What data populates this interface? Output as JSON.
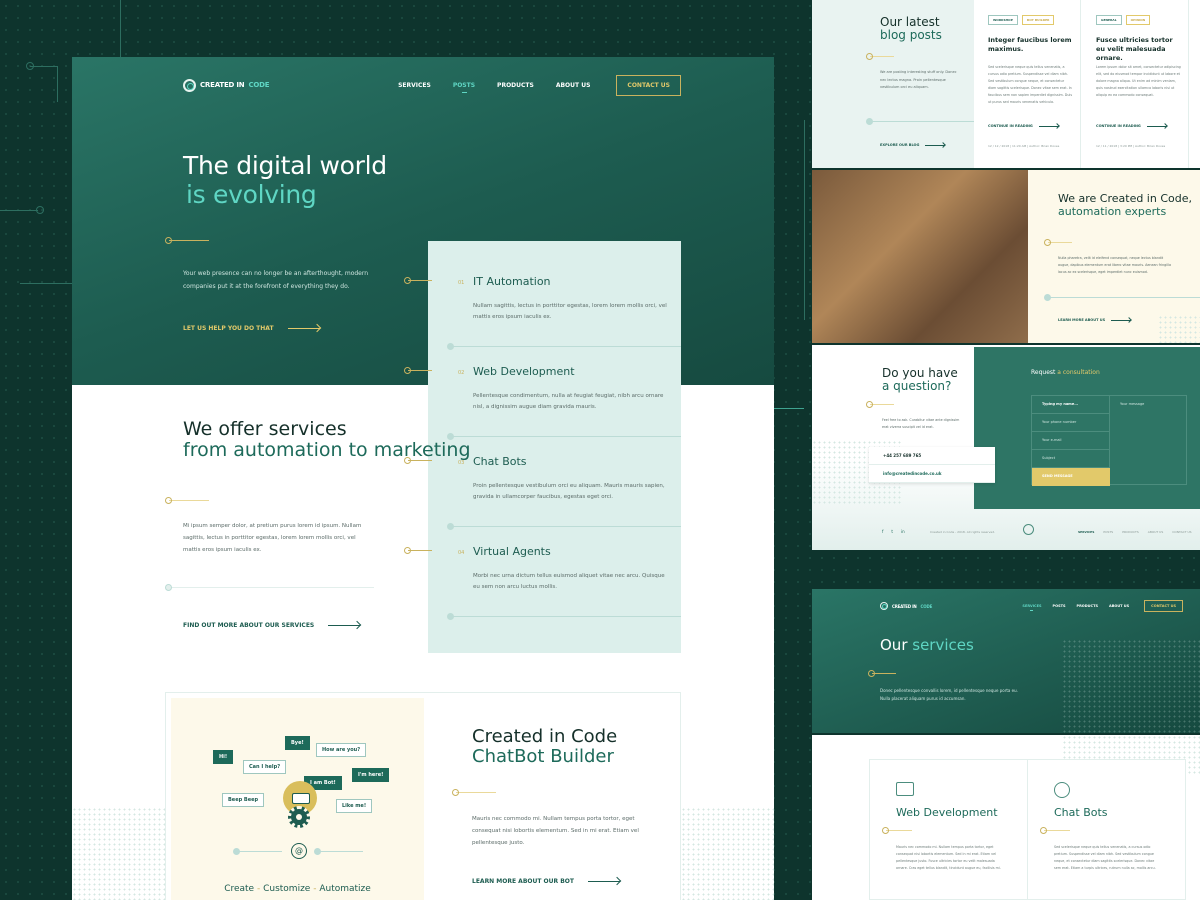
{
  "brand": {
    "name": "CREATED IN",
    "name_accent": "CODE"
  },
  "nav": {
    "items": [
      {
        "label": "SERVICES"
      },
      {
        "label": "POSTS",
        "active": true
      },
      {
        "label": "PRODUCTS"
      },
      {
        "label": "ABOUT US"
      }
    ],
    "contact_label": "CONTACT US"
  },
  "hero": {
    "title_line1": "The digital world",
    "title_line2": "is evolving",
    "text": "Your web presence can no longer be an afterthought, modern companies put it at the forefront of everything they do.",
    "cta": "LET US HELP YOU DO THAT"
  },
  "services": [
    {
      "num": "01",
      "title": "IT Automation",
      "text": "Nullam sagittis, lectus in porttitor egestas, lorem lorem mollis orci, vel mattis eros ipsum iaculis ex."
    },
    {
      "num": "02",
      "title": "Web Development",
      "text": "Pellentesque condimentum, nulla at feugiat feugiat, nibh arcu ornare nisl, a dignissim augue diam gravida mauris."
    },
    {
      "num": "03",
      "title": "Chat Bots",
      "text": "Proin pellentesque vestibulum orci eu aliquam. Mauris mauris sapien, gravida in ullamcorper faucibus, egestas eget orci."
    },
    {
      "num": "04",
      "title": "Virtual Agents",
      "text": "Morbi nec urna dictum tellus euismod aliquet vitae nec arcu. Quisque eu sem non arcu luctus mollis."
    }
  ],
  "offer": {
    "title_line1": "We offer services",
    "title_line2": "from automation to marketing",
    "text": "Mi ipsum semper dolor, at pretium purus lorem id ipsum. Nullam sagittis, lectus in porttitor egestas, lorem lorem mollis orci, vel mattis eros ipsum iaculis ex.",
    "cta": "FIND OUT MORE ABOUT OUR SERVICES"
  },
  "chatbot": {
    "bubbles": [
      "Hi!",
      "Bye!",
      "How are you?",
      "Can I help?",
      "I am Bot!",
      "I'm here!",
      "Beep Beep",
      "Like me!"
    ],
    "tagline": [
      "Create",
      "Customize",
      "Automatize"
    ],
    "separator": "-",
    "title_line1": "Created in Code",
    "title_line2": "ChatBot Builder",
    "text": "Mauris nec commodo mi. Nullam tempus porta tortor, eget consequat nisi lobortis elementum. Sed in mi erat. Etiam vel pellentesque justo.",
    "cta": "LEARN MORE ABOUT OUR BOT"
  },
  "blog": {
    "title_line1": "Our latest",
    "title_line2": "blog posts",
    "text": "We are posting interesting stuff only. Donec nec lectus magna. Proin pellentesque vestibulum orci eu aliquam.",
    "cta": "EXPLORE OUR BLOG",
    "posts": [
      {
        "tags": [
          "WORKSHOP",
          "BOT BUILDER"
        ],
        "title": "Integer faucibus lorem maximus.",
        "text": "Sed scelerisque neque quis tellus venenatis, a cursus odio pretium. Suspendisse vel diam nibh. Sed vestibulum congue neque, et consectetur diam sagittis scelerisque. Donec vitae sem erat. In faucibus sem non sapien imperdiet dignissim. Duis ut purus sed mauris venenatis vehicula.",
        "cta": "CONTINUE IN READING",
        "meta": "12 / 12 / 2018 | 11:20 AM | Author: Brian Doves"
      },
      {
        "tags": [
          "GENERAL",
          "OPINION"
        ],
        "title": "Fusce ultricies tortor eu velit malesuada ornare.",
        "text": "Lorem ipsum dolor sit amet, consectetur adipiscing elit, sed do eiusmod tempor incididunt ut labore et dolore magna aliqua. Ut enim ad minim veniam, quis nostrud exercitation ullamco laboris nisi ut aliquip ex ea commodo consequat.",
        "cta": "CONTINUE IN READING",
        "meta": "12 / 11 / 2018 | 3:20 PM | Author: Brian Doves"
      }
    ]
  },
  "about": {
    "title_line1": "We are Created in Code,",
    "title_accent": "automation experts",
    "text": "Nulla pharetra, velit id eleifend consequat, neque lectus blandit augue, dapibus elementum erat libero vitae mauris. Aenean fringilla lacus ac ex scelerisque, eget imperdiet nunc euismod.",
    "cta": "LEARN MORE ABOUT US"
  },
  "question": {
    "title_line1": "Do you have",
    "title_line2": "a question?",
    "text": "Feel free to ask. Curabitur vitae ante dignissim erat viverra suscipit vel id erat.",
    "phone": "+44 257 689 765",
    "email": "info@createdincode.co.uk"
  },
  "consult": {
    "title": "Request",
    "title_accent": "a consultation",
    "name_value": "Typing my name...",
    "phone_placeholder": "Your phone number",
    "email_placeholder": "Your e-mail",
    "subject_placeholder": "Subject",
    "message_placeholder": "Your message",
    "send_label": "SEND MESSAGE"
  },
  "footer": {
    "social": [
      "f",
      "t",
      "in"
    ],
    "copyright": "Created in Code - 2018. All rights reserved.",
    "links": [
      "SERVICES",
      "POSTS",
      "PRODUCTS",
      "ABOUT US",
      "CONTACT US"
    ]
  },
  "services_page": {
    "nav_items": [
      "SERVICES",
      "POSTS",
      "PRODUCTS",
      "ABOUT US"
    ],
    "contact_label": "CONTACT US",
    "title": "Our",
    "title_accent": "services",
    "text": "Donec pellentesque convallis lorem, id pellentesque neque porta eu. Nulla placerat aliquam purus id accumsan.",
    "cards": [
      {
        "title": "Web Development",
        "text": "Mauris nec commodo mi. Nullam tempus porta tortor, eget consequat nisi lobortis elementum. Sed in mi erat. Etiam vel pellentesque justo. Fusce ultricies tortor eu velit malesuada ornare. Cras eget tellus blandit, tincidunt augue eu, facilisis mi."
      },
      {
        "title": "Chat Bots",
        "text": "Sed scelerisque neque quis tellus venenatis, a cursus odio pretium. Suspendisse vel diam nibh. Sed vestibulum congue neque, et consectetur diam sagittis scelerisque. Donec vitae sem erat. Etiam a turpis ultrices, rutrum nulla ac, mollis arcu."
      }
    ]
  }
}
